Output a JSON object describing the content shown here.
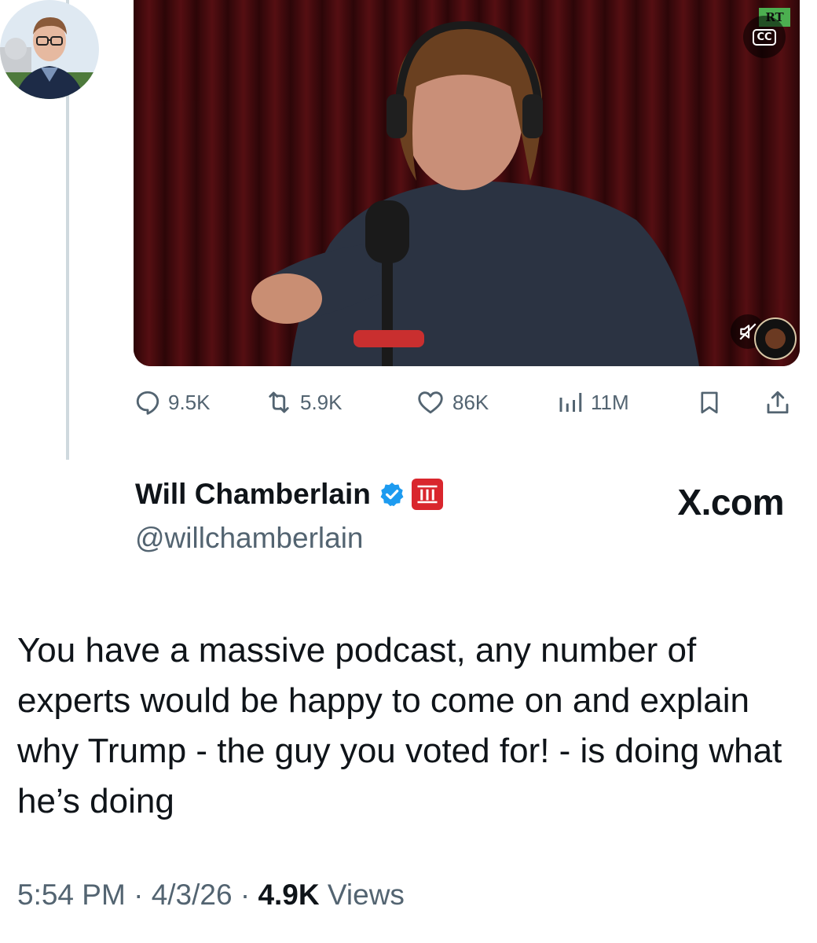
{
  "media": {
    "cc_label": "CC",
    "channel_badge": "RT"
  },
  "actions": {
    "replies": "9.5K",
    "reposts": "5.9K",
    "likes": "86K",
    "views": "11M"
  },
  "author": {
    "name": "Will Chamberlain",
    "handle": "@willchamberlain"
  },
  "source_label": "X.com",
  "tweet": {
    "text": "You have a massive podcast, any number of experts would be happy to come on and explain why Trump - the guy you voted for! - is doing what he’s doing",
    "time": "5:54 PM",
    "date": "4/3/26",
    "views_count": "4.9K",
    "views_label": "Views",
    "separator": "·"
  },
  "colors": {
    "secondary_text": "#536471",
    "verified_blue": "#1d9bf0",
    "affiliation_red": "#d9262d"
  },
  "icons": [
    "closed-captions-icon",
    "mute-icon",
    "reply-icon",
    "repost-icon",
    "like-icon",
    "views-icon",
    "bookmark-icon",
    "share-icon",
    "verified-badge-icon",
    "affiliation-badge-icon"
  ]
}
